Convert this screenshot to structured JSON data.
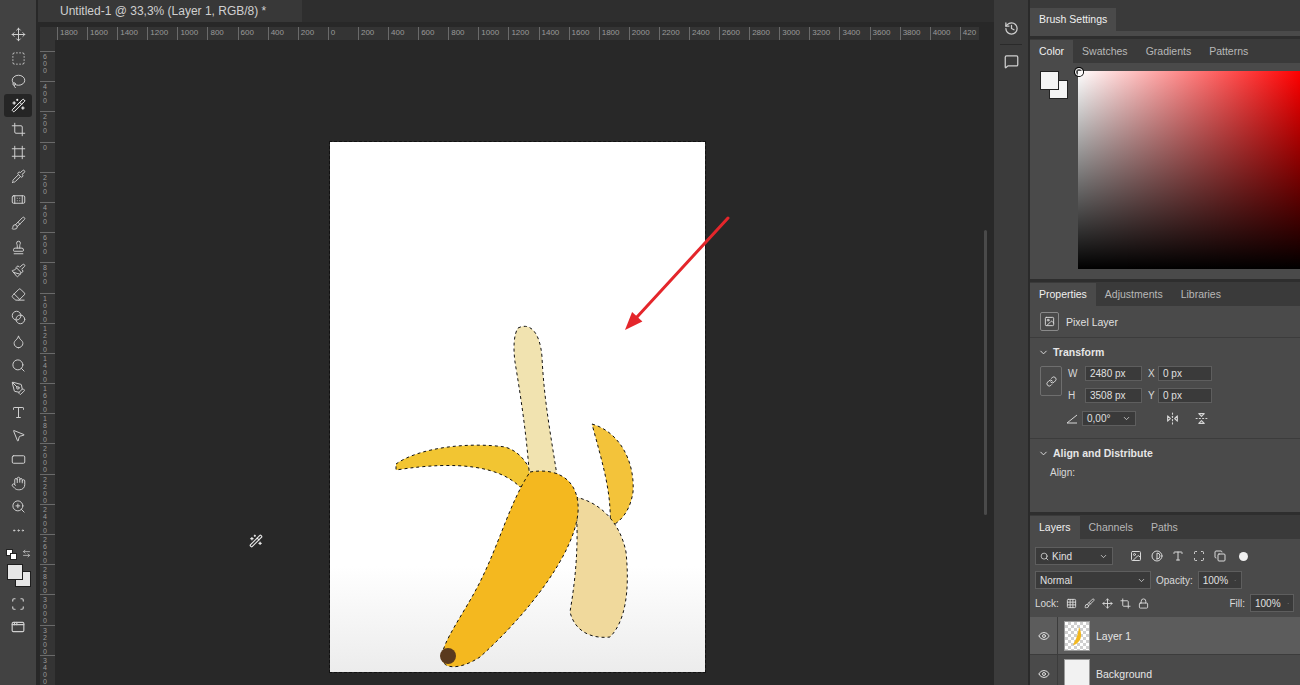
{
  "document": {
    "title": "Untitled-1 @ 33,3% (Layer 1, RGB/8) *"
  },
  "rulers": {
    "horizontal": [
      "1800",
      "1600",
      "1400",
      "1200",
      "1000",
      "800",
      "600",
      "400",
      "200",
      "0",
      "200",
      "400",
      "600",
      "800",
      "1000",
      "1200",
      "1400",
      "1600",
      "1800",
      "2000",
      "2200",
      "2400",
      "2600",
      "2800",
      "3000",
      "3200",
      "3400",
      "3600",
      "3800",
      "4000",
      "420"
    ],
    "vertical": [
      "600",
      "400",
      "200",
      "0",
      "200",
      "400",
      "600",
      "800",
      "1000",
      "1200",
      "1400",
      "1600",
      "1800",
      "2000",
      "2200",
      "2400",
      "2600",
      "2800",
      "3000",
      "3200",
      "3400"
    ]
  },
  "tools": [
    {
      "selected": false
    },
    {
      "selected": false
    },
    {
      "selected": false
    },
    {
      "selected": true
    },
    {
      "selected": false
    },
    {
      "selected": false
    },
    {
      "selected": false
    },
    {
      "selected": false
    },
    {
      "selected": false
    },
    {
      "selected": false
    },
    {
      "selected": false
    },
    {
      "selected": false
    },
    {
      "selected": false
    },
    {
      "selected": false
    },
    {
      "selected": false
    },
    {
      "selected": false
    },
    {
      "selected": false
    },
    {
      "selected": false
    },
    {
      "selected": false
    },
    {
      "selected": false
    },
    {
      "selected": false
    },
    {
      "selected": false
    }
  ],
  "panels": {
    "brush_settings": {
      "label": "Brush Settings"
    },
    "color": {
      "tabs": [
        {
          "label": "Color",
          "selected": true
        },
        {
          "label": "Swatches",
          "selected": false
        },
        {
          "label": "Gradients",
          "selected": false
        },
        {
          "label": "Patterns",
          "selected": false
        }
      ]
    },
    "properties": {
      "tabs": [
        {
          "label": "Properties",
          "selected": true
        },
        {
          "label": "Adjustments",
          "selected": false
        },
        {
          "label": "Libraries",
          "selected": false
        }
      ],
      "layer_kind": "Pixel Layer",
      "transform": {
        "title": "Transform",
        "expanded": true,
        "width": {
          "label": "W",
          "value": "2480 px"
        },
        "height": {
          "label": "H",
          "value": "3508 px"
        },
        "x": {
          "label": "X",
          "value": "0 px"
        },
        "y": {
          "label": "Y",
          "value": "0 px"
        },
        "angle": "0,00°"
      },
      "align": {
        "title": "Align and Distribute",
        "expanded": true,
        "label": "Align:"
      }
    },
    "layers": {
      "tabs": [
        {
          "label": "Layers",
          "selected": true
        },
        {
          "label": "Channels",
          "selected": false
        },
        {
          "label": "Paths",
          "selected": false
        }
      ],
      "filter": "Kind",
      "blend_mode": "Normal",
      "opacity": {
        "label": "Opacity:",
        "value": "100%"
      },
      "lock": {
        "label": "Lock:"
      },
      "fill": {
        "label": "Fill:",
        "value": "100%"
      },
      "items": [
        {
          "name": "Layer 1",
          "kind": "layer",
          "selected": true,
          "visible": true
        },
        {
          "name": "Background",
          "kind": "background",
          "selected": false,
          "visible": true
        }
      ]
    }
  }
}
